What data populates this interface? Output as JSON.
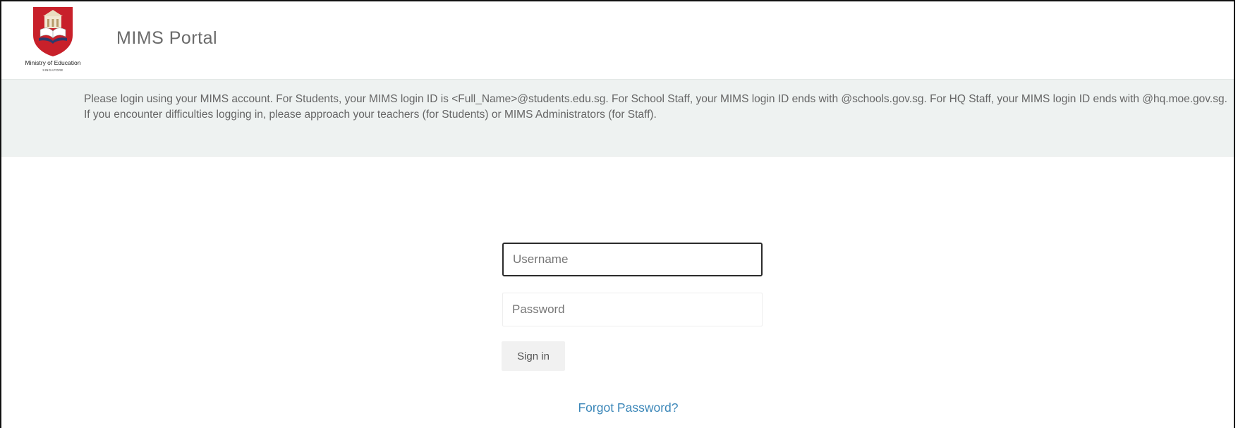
{
  "header": {
    "logo": {
      "name": "Ministry of Education",
      "subtext": "SINGAPORE"
    },
    "title": "MIMS Portal"
  },
  "banner": {
    "text": "Please login using your MIMS account. For Students, your MIMS login ID is <Full_Name>@students.edu.sg. For School Staff, your MIMS login ID ends with @schools.gov.sg. For HQ Staff, your MIMS login ID ends with @hq.moe.gov.sg. If you encounter difficulties logging in, please approach your teachers (for Students) or MIMS Administrators (for Staff)."
  },
  "login": {
    "username": {
      "placeholder": "Username",
      "value": ""
    },
    "password": {
      "placeholder": "Password",
      "value": ""
    },
    "signin_label": "Sign in",
    "forgot_label": "Forgot Password?"
  },
  "colors": {
    "banner_bg": "#eef2f1",
    "link": "#3a86b8",
    "crest_red": "#c8202a"
  }
}
